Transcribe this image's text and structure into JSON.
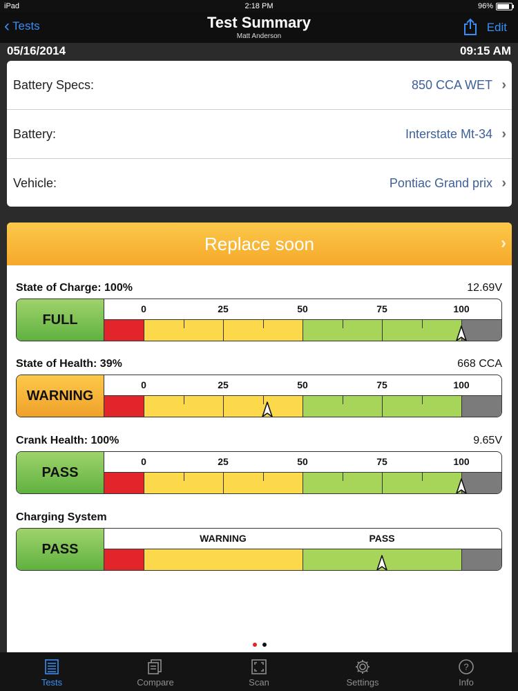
{
  "status": {
    "device": "iPad",
    "time": "2:18 PM",
    "battery": "96%"
  },
  "nav": {
    "back_label": "Tests",
    "title": "Test Summary",
    "subtitle": "Matt Anderson",
    "edit_label": "Edit"
  },
  "date_row": {
    "date": "05/16/2014",
    "time": "09:15 AM"
  },
  "info": [
    {
      "label": "Battery Specs:",
      "value": "850 CCA WET"
    },
    {
      "label": "Battery:",
      "value": "Interstate Mt-34"
    },
    {
      "label": "Vehicle:",
      "value": "Pontiac Grand prix"
    }
  ],
  "result": {
    "banner": "Replace soon",
    "banner_color": "#f8b33a"
  },
  "metrics": [
    {
      "title": "State of Charge: 100%",
      "value": "12.69V",
      "badge": "FULL",
      "badge_color": "green",
      "ticks": [
        "0",
        "25",
        "50",
        "75",
        "100"
      ],
      "pointer_percent": 100
    },
    {
      "title": "State of Health: 39%",
      "value": "668 CCA",
      "badge": "WARNING",
      "badge_color": "orange",
      "ticks": [
        "0",
        "25",
        "50",
        "75",
        "100"
      ],
      "pointer_percent": 39
    },
    {
      "title": "Crank Health: 100%",
      "value": "9.65V",
      "badge": "PASS",
      "badge_color": "green",
      "ticks": [
        "0",
        "25",
        "50",
        "75",
        "100"
      ],
      "pointer_percent": 100
    },
    {
      "title": "Charging System",
      "value": "",
      "badge": "PASS",
      "badge_color": "green",
      "zone_labels": [
        "WARNING",
        "PASS"
      ],
      "pointer_percent": 75
    }
  ],
  "pager": {
    "count": 2,
    "active": 0
  },
  "tabs": [
    {
      "label": "Tests",
      "icon": "list-icon",
      "active": true
    },
    {
      "label": "Compare",
      "icon": "documents-icon",
      "active": false
    },
    {
      "label": "Scan",
      "icon": "scan-icon",
      "active": false
    },
    {
      "label": "Settings",
      "icon": "gear-icon",
      "active": false
    },
    {
      "label": "Info",
      "icon": "question-icon",
      "active": false
    }
  ]
}
